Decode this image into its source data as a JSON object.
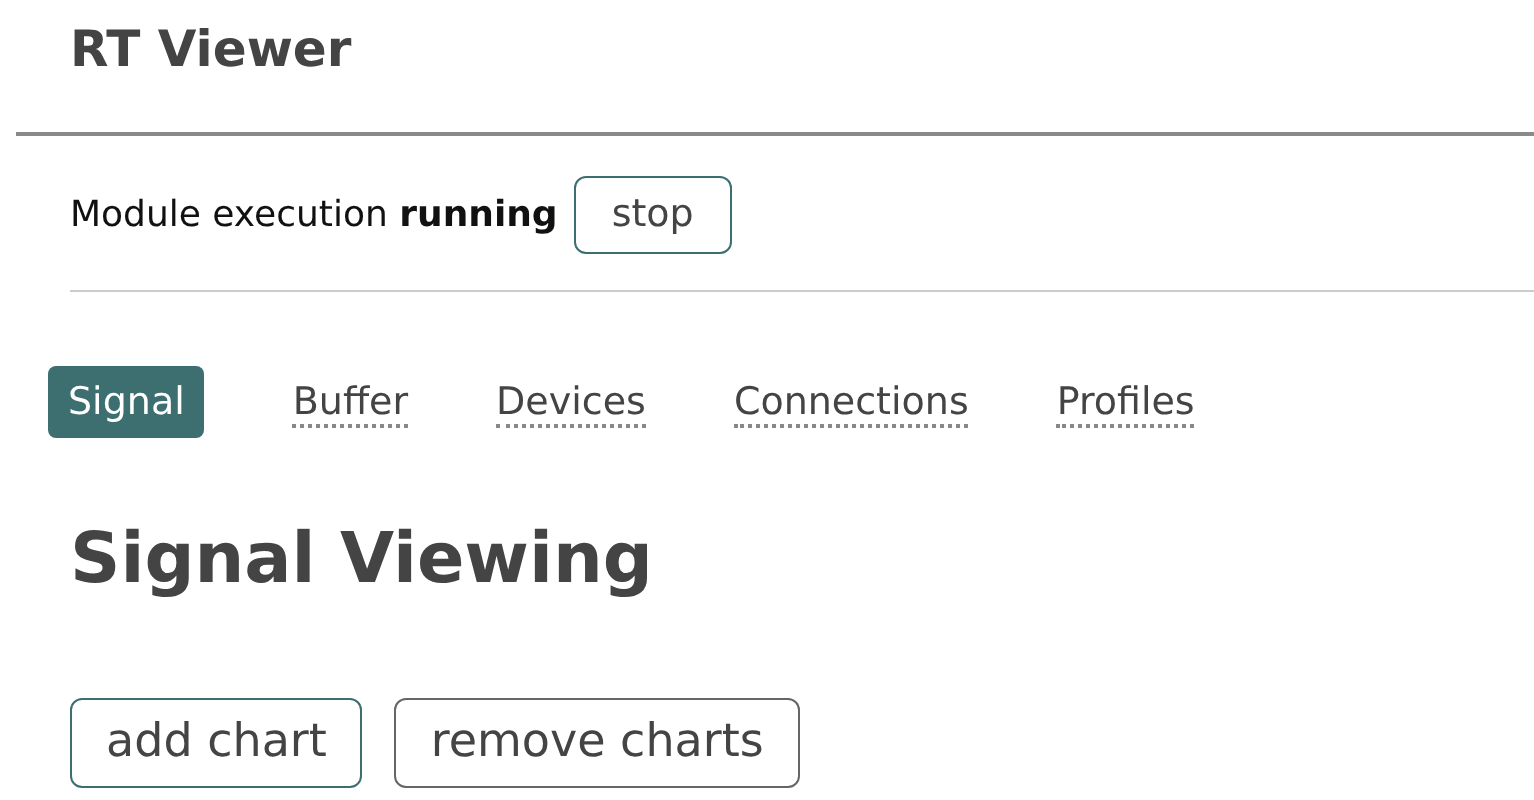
{
  "header": {
    "title": "RT Viewer"
  },
  "status": {
    "text": "Module execution **running**",
    "button": "stop"
  },
  "tabs": [
    {
      "label": "Signal",
      "selected": true
    },
    {
      "label": "Buffer",
      "selected": false
    },
    {
      "label": "Devices",
      "selected": false
    },
    {
      "label": "Connections",
      "selected": false
    },
    {
      "label": "Profiles",
      "selected": false
    }
  ],
  "heading": "Signal Viewing",
  "buttons": [
    {
      "label": "add chart",
      "kind": "primary"
    },
    {
      "label": "remove charts",
      "kind": "secondary"
    }
  ]
}
